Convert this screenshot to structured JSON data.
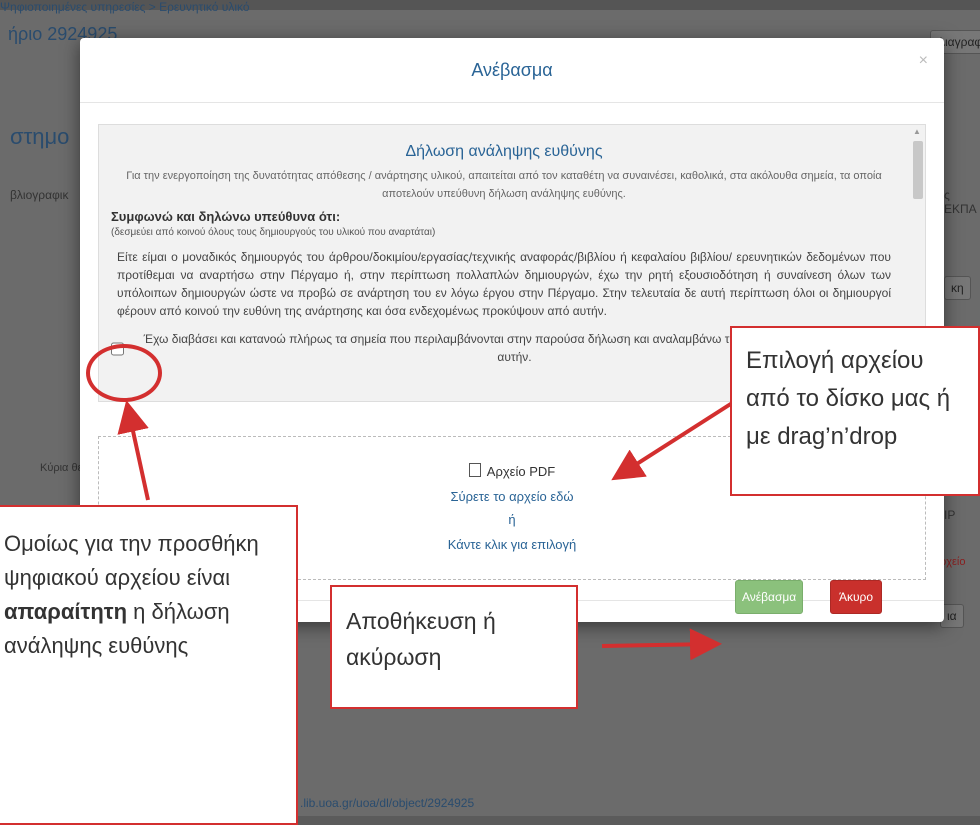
{
  "background": {
    "breadcrumb": "Ψηφιοποιημένες υπηρεσίες > Ερευνητικό υλικό",
    "title": "ήριο 2924925",
    "heading": "στημο",
    "tab_left": "βλιογραφικ",
    "tab_right": "ς ΕΚΠΑ",
    "delete_btn": "Διαγραφ",
    "side_label": "Κύρια θεματ",
    "right_btn1": "κη",
    "right_p": "IP",
    "right_file": "ρχείο",
    "right_btn2": "ια",
    "url": ".lib.uoa.gr/uoa/dl/object/2924925"
  },
  "modal": {
    "title": "Ανέβασμα",
    "close": "×",
    "declaration": {
      "title": "Δήλωση ανάληψης ευθύνης",
      "intro": "Για την ενεργοποίηση της δυνατότητας απόθεσης / ανάρτησης υλικού, απαιτείται από τον καταθέτη να συναινέσει, καθολικά, στα ακόλουθα σημεία, τα οποία αποτελούν υπεύθυνη δήλωση ανάληψης ευθύνης.",
      "agree_heading": "Συμφωνώ και δηλώνω υπεύθυνα ότι:",
      "agree_note": "(δεσμεύει από κοινού όλους τους δημιουργούς του υλικού που αναρτάται)",
      "body": "Είτε είμαι ο μοναδικός δημιουργός του άρθρου/δοκιμίου/εργασίας/τεχνικής αναφοράς/βιβλίου ή κεφαλαίου βιβλίου/ ερευνητικών δεδομένων που προτίθεμαι να αναρτήσω στην Πέργαμο ή, στην περίπτωση πολλαπλών δημιουργών, έχω την ρητή εξουσιοδότηση ή συναίνεση όλων των υπόλοιπων δημιουργών ώστε να προβώ σε ανάρτηση του εν λόγω έργου στην Πέργαμο. Στην τελευταία δε αυτή περίπτωση όλοι οι δημιουργοί φέρουν από κοινού την ευθύνη της ανάρτησης και όσα ενδεχομένως προκύψουν από αυτήν.",
      "checkbox_label": "Έχω διαβάσει και κατανοώ πλήρως τα σημεία που περιλαμβάνονται στην παρούσα δήλωση και αναλαμβάνω την ευθύνη που απορρέει από αυτήν."
    },
    "dropzone": {
      "filetype": "Αρχείο PDF",
      "drag_text": "Σύρετε το αρχείο εδώ",
      "or": "ή",
      "click_text": "Κάντε κλικ για επιλογή"
    },
    "upload_button": "Ανέβασμα",
    "cancel_button": "Άκυρο"
  },
  "callouts": {
    "file_select": "Επιλογή αρχείου από το δίσκο μας ή με drag’n’drop",
    "declaration_pre": "Ομοίως για την προσθήκη ψηφιακού αρχείου είναι ",
    "declaration_bold": "απαραίτητη",
    "declaration_post": " η δήλωση ανάληψης ευθύνης",
    "save_cancel": "Αποθήκευση ή ακύρωση"
  },
  "colors": {
    "accent": "#2a6496",
    "success": "#8bc17c",
    "danger": "#c9302c",
    "annotation": "#d32f2f"
  }
}
